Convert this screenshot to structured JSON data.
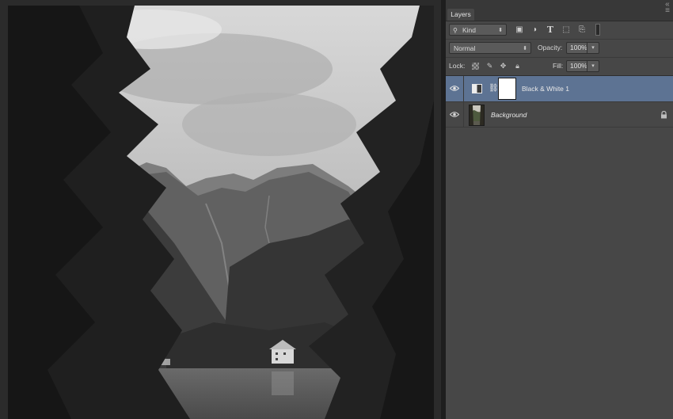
{
  "panel": {
    "tab_label": "Layers",
    "menu_icon": "panel-menu-icon"
  },
  "filter": {
    "kind_label": "Kind",
    "icons": [
      "pixel-layer-filter-icon",
      "adjustment-layer-filter-icon",
      "type-layer-filter-icon",
      "shape-layer-filter-icon",
      "smart-object-filter-icon"
    ]
  },
  "blend": {
    "mode": "Normal",
    "opacity_label": "Opacity:",
    "opacity_value": "100%"
  },
  "lock": {
    "label": "Lock:",
    "fill_label": "Fill:",
    "fill_value": "100%"
  },
  "layers": [
    {
      "name": "Black & White 1",
      "visible": true,
      "selected": true,
      "type": "adjustment"
    },
    {
      "name": "Background",
      "visible": true,
      "selected": false,
      "locked": true,
      "type": "image"
    }
  ],
  "colors": {
    "selected_row": "#5d7393",
    "panel_bg": "#474747",
    "canvas_bg": "#2b2b2b"
  }
}
